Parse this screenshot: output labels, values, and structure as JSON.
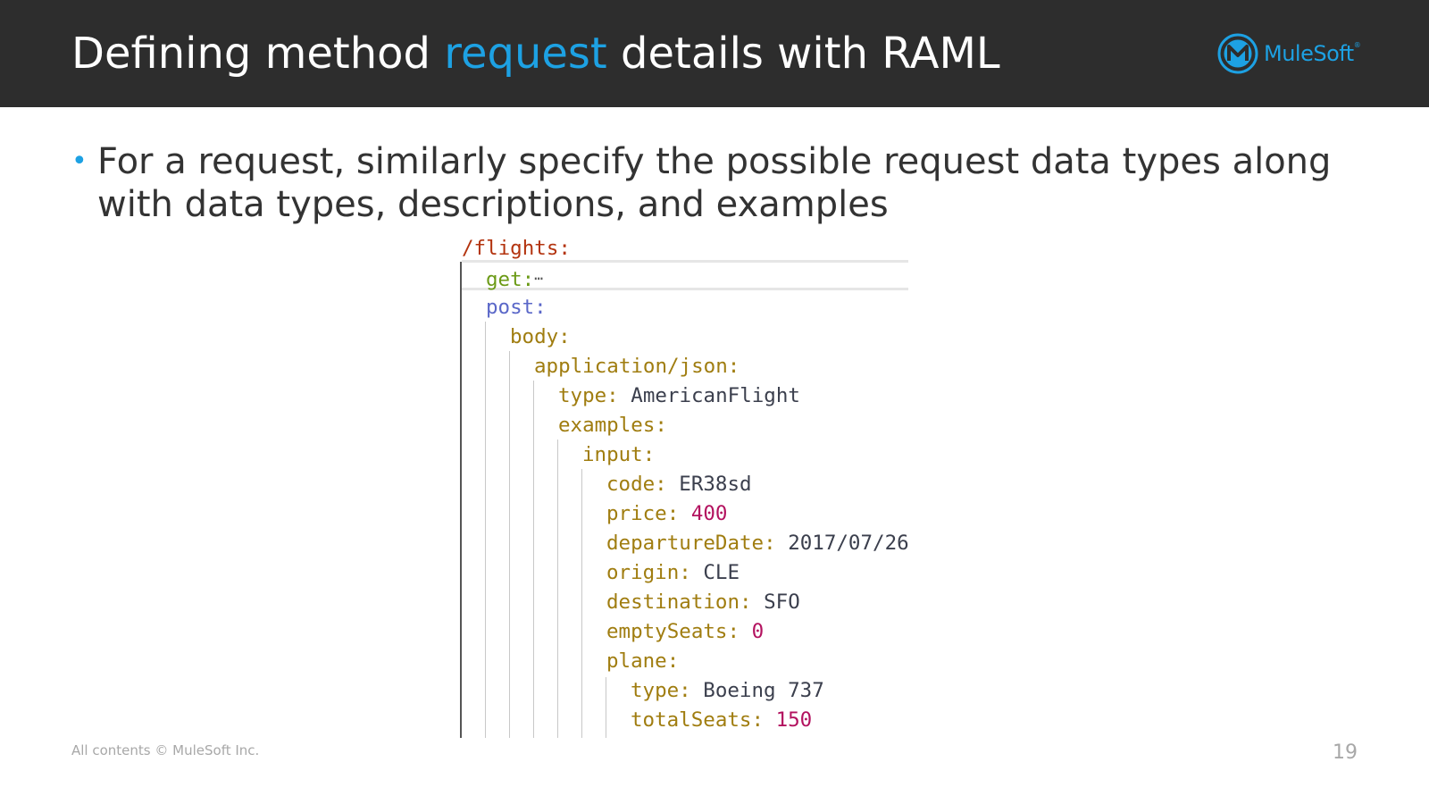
{
  "header": {
    "title_before": "Defining method ",
    "title_highlight": "request",
    "title_after": " details with RAML",
    "highlight_color": "#1da1e3",
    "background_color": "#2d2d2d"
  },
  "logo": {
    "text": "MuleSoft",
    "mark": "®",
    "icon": "mulesoft-logo-icon"
  },
  "bullet": {
    "text": "For a request, similarly specify the possible request data types along with data types, descriptions, and examples"
  },
  "code": {
    "lines": [
      {
        "key": "/flights:",
        "value": ""
      },
      {
        "key": "get:",
        "value": "⋯"
      },
      {
        "key": "post:",
        "value": ""
      },
      {
        "key": "body:",
        "value": ""
      },
      {
        "key": "application/json:",
        "value": ""
      },
      {
        "key": "type:",
        "value": "AmericanFlight"
      },
      {
        "key": "examples:",
        "value": ""
      },
      {
        "key": "input:",
        "value": ""
      },
      {
        "key": "code:",
        "value": "ER38sd"
      },
      {
        "key": "price:",
        "value": "400"
      },
      {
        "key": "departureDate:",
        "value": "2017/07/26"
      },
      {
        "key": "origin:",
        "value": "CLE"
      },
      {
        "key": "destination:",
        "value": "SFO"
      },
      {
        "key": "emptySeats:",
        "value": "0"
      },
      {
        "key": "plane:",
        "value": ""
      },
      {
        "key": "type:",
        "value": "Boeing 737"
      },
      {
        "key": "totalSeats:",
        "value": "150"
      }
    ]
  },
  "footer": {
    "copyright": "All contents © MuleSoft Inc.",
    "page_number": "19"
  }
}
